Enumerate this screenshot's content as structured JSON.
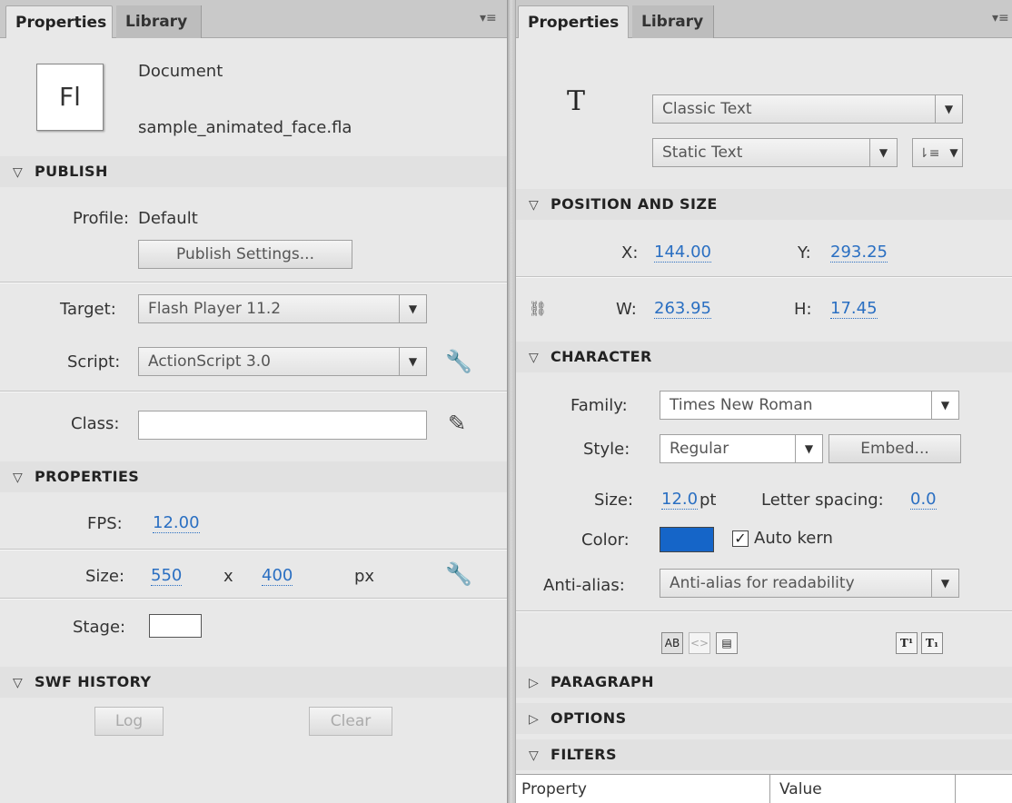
{
  "left": {
    "tabs": [
      "Properties",
      "Library"
    ],
    "document": {
      "icon_text": "Fl",
      "type": "Document",
      "filename": "sample_animated_face.fla"
    },
    "publish": {
      "title": "PUBLISH",
      "profile_label": "Profile:",
      "profile_value": "Default",
      "settings_button": "Publish Settings...",
      "target_label": "Target:",
      "target_value": "Flash Player 11.2",
      "script_label": "Script:",
      "script_value": "ActionScript 3.0",
      "class_label": "Class:",
      "class_value": ""
    },
    "properties": {
      "title": "PROPERTIES",
      "fps_label": "FPS:",
      "fps_value": "12.00",
      "size_label": "Size:",
      "width": "550",
      "x_sep": "x",
      "height": "400",
      "unit": "px",
      "stage_label": "Stage:"
    },
    "swf_history": {
      "title": "SWF HISTORY",
      "log_button": "Log",
      "clear_button": "Clear"
    }
  },
  "right": {
    "tabs": [
      "Properties",
      "Library"
    ],
    "tool_icon": "T",
    "text_engine": "Classic Text",
    "text_type": "Static Text",
    "position": {
      "title": "POSITION AND SIZE",
      "x_label": "X:",
      "x_value": "144.00",
      "y_label": "Y:",
      "y_value": "293.25",
      "w_label": "W:",
      "w_value": "263.95",
      "h_label": "H:",
      "h_value": "17.45"
    },
    "character": {
      "title": "CHARACTER",
      "family_label": "Family:",
      "family_value": "Times New Roman",
      "style_label": "Style:",
      "style_value": "Regular",
      "embed_button": "Embed...",
      "size_label": "Size:",
      "size_value": "12.0",
      "size_unit": "pt",
      "letter_spacing_label": "Letter spacing:",
      "letter_spacing_value": "0.0",
      "color_label": "Color:",
      "color_value": "#1565c8",
      "auto_kern_label": "Auto kern",
      "auto_kern_checked": true,
      "antialias_label": "Anti-alias:",
      "antialias_value": "Anti-alias for readability"
    },
    "paragraph_title": "PARAGRAPH",
    "options_title": "OPTIONS",
    "filters_title": "FILTERS",
    "table": {
      "col_property": "Property",
      "col_value": "Value"
    }
  }
}
